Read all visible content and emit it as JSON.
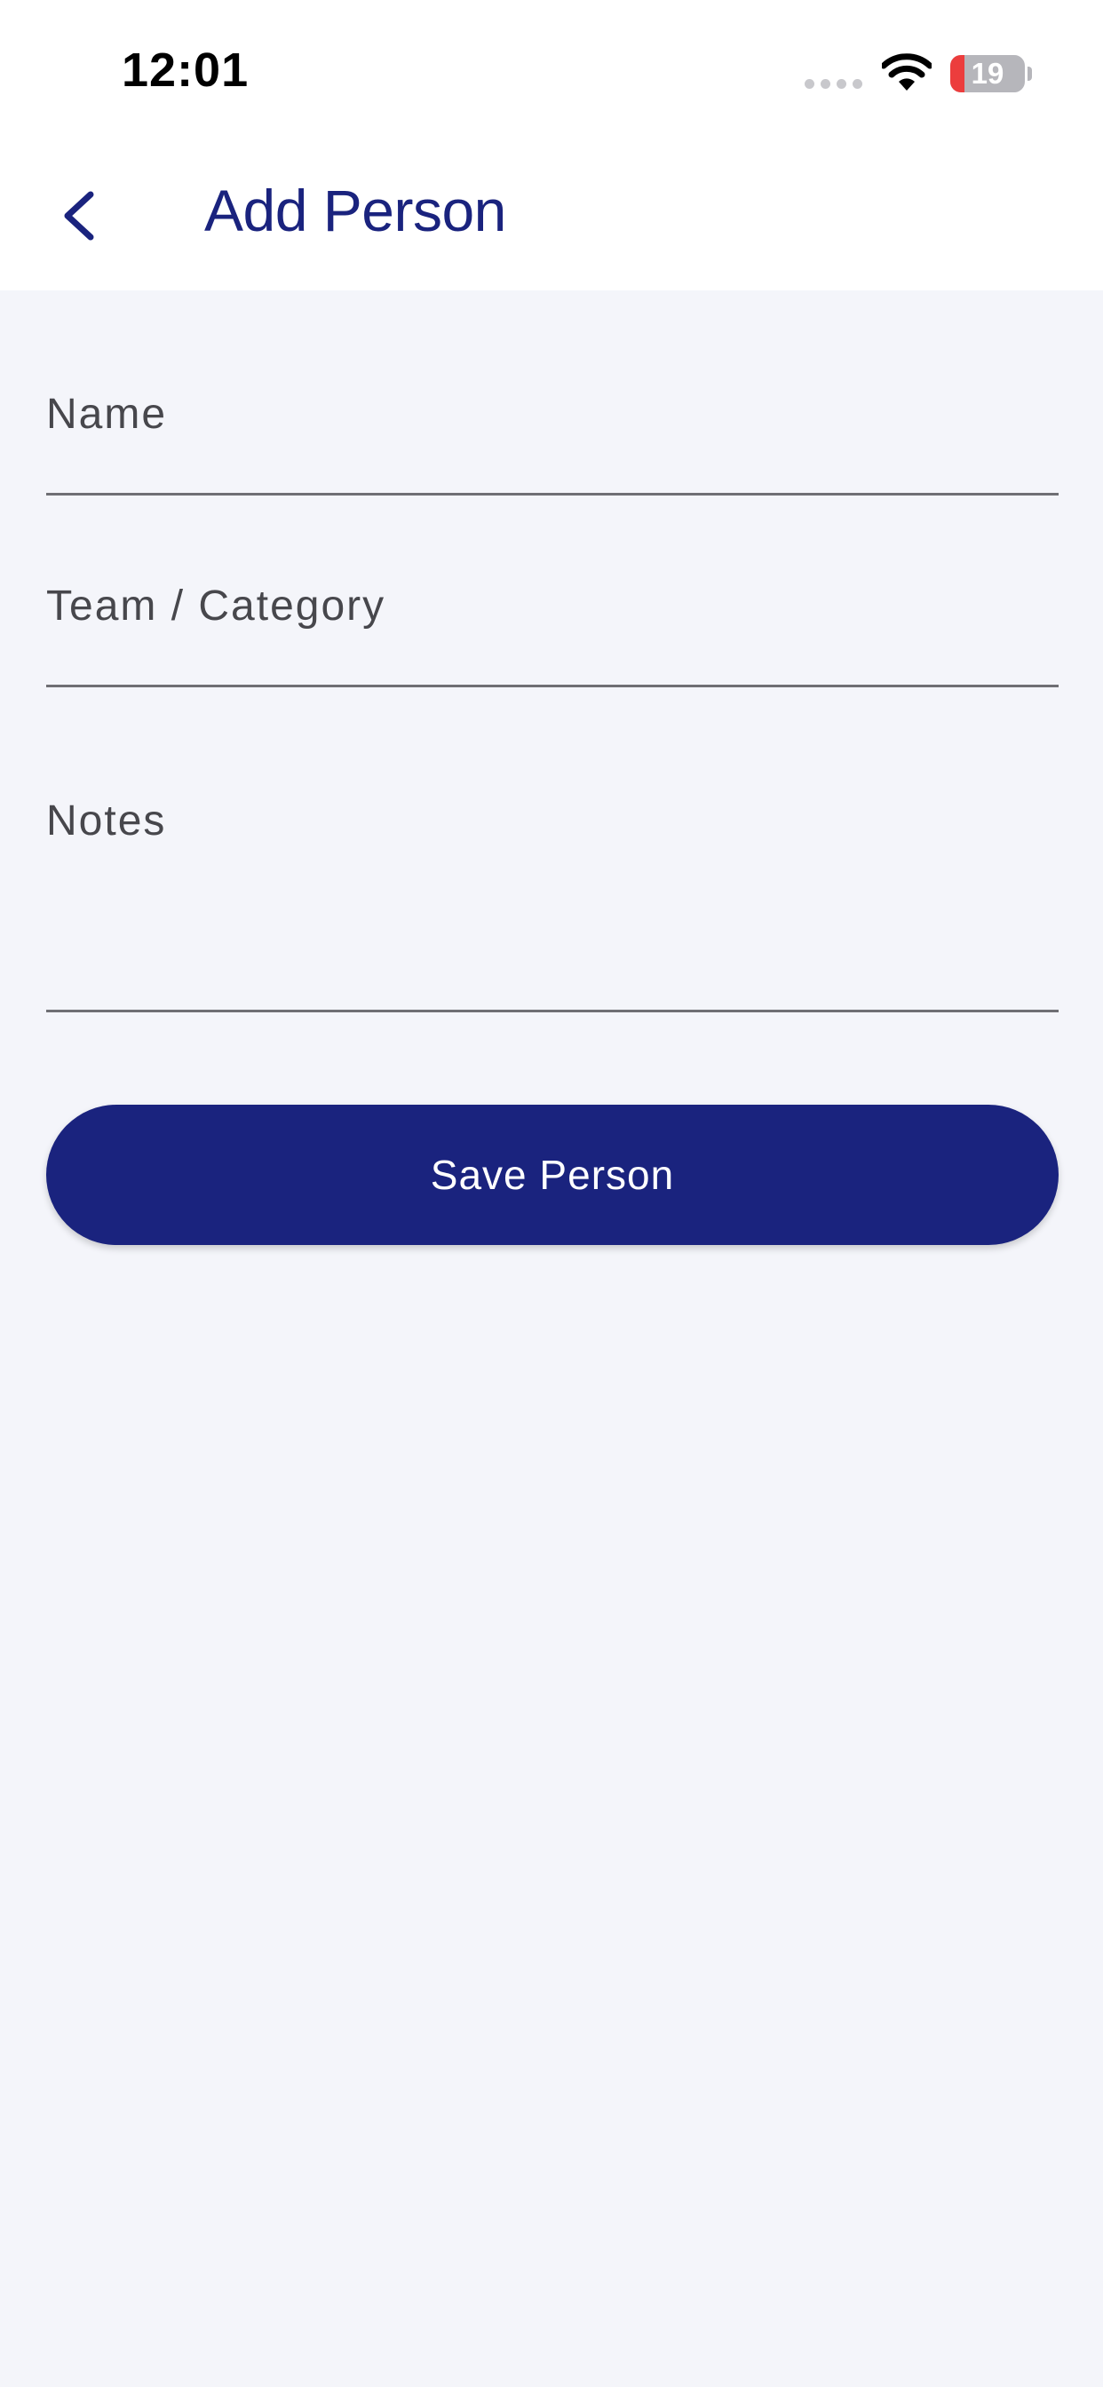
{
  "status_bar": {
    "time": "12:01",
    "battery_percent": "19",
    "battery_level": 0.19
  },
  "app_bar": {
    "back_icon": "chevron-left-icon",
    "title": "Add Person"
  },
  "form": {
    "name_label": "Name",
    "name_value": "",
    "team_label": "Team / Category",
    "team_value": "",
    "notes_label": "Notes",
    "notes_value": ""
  },
  "actions": {
    "save_label": "Save Person"
  },
  "colors": {
    "primary": "#1a237e",
    "background": "#f4f5fa",
    "label": "#47474c",
    "underline": "#6f6f74",
    "battery_low": "#ec3d3d"
  }
}
